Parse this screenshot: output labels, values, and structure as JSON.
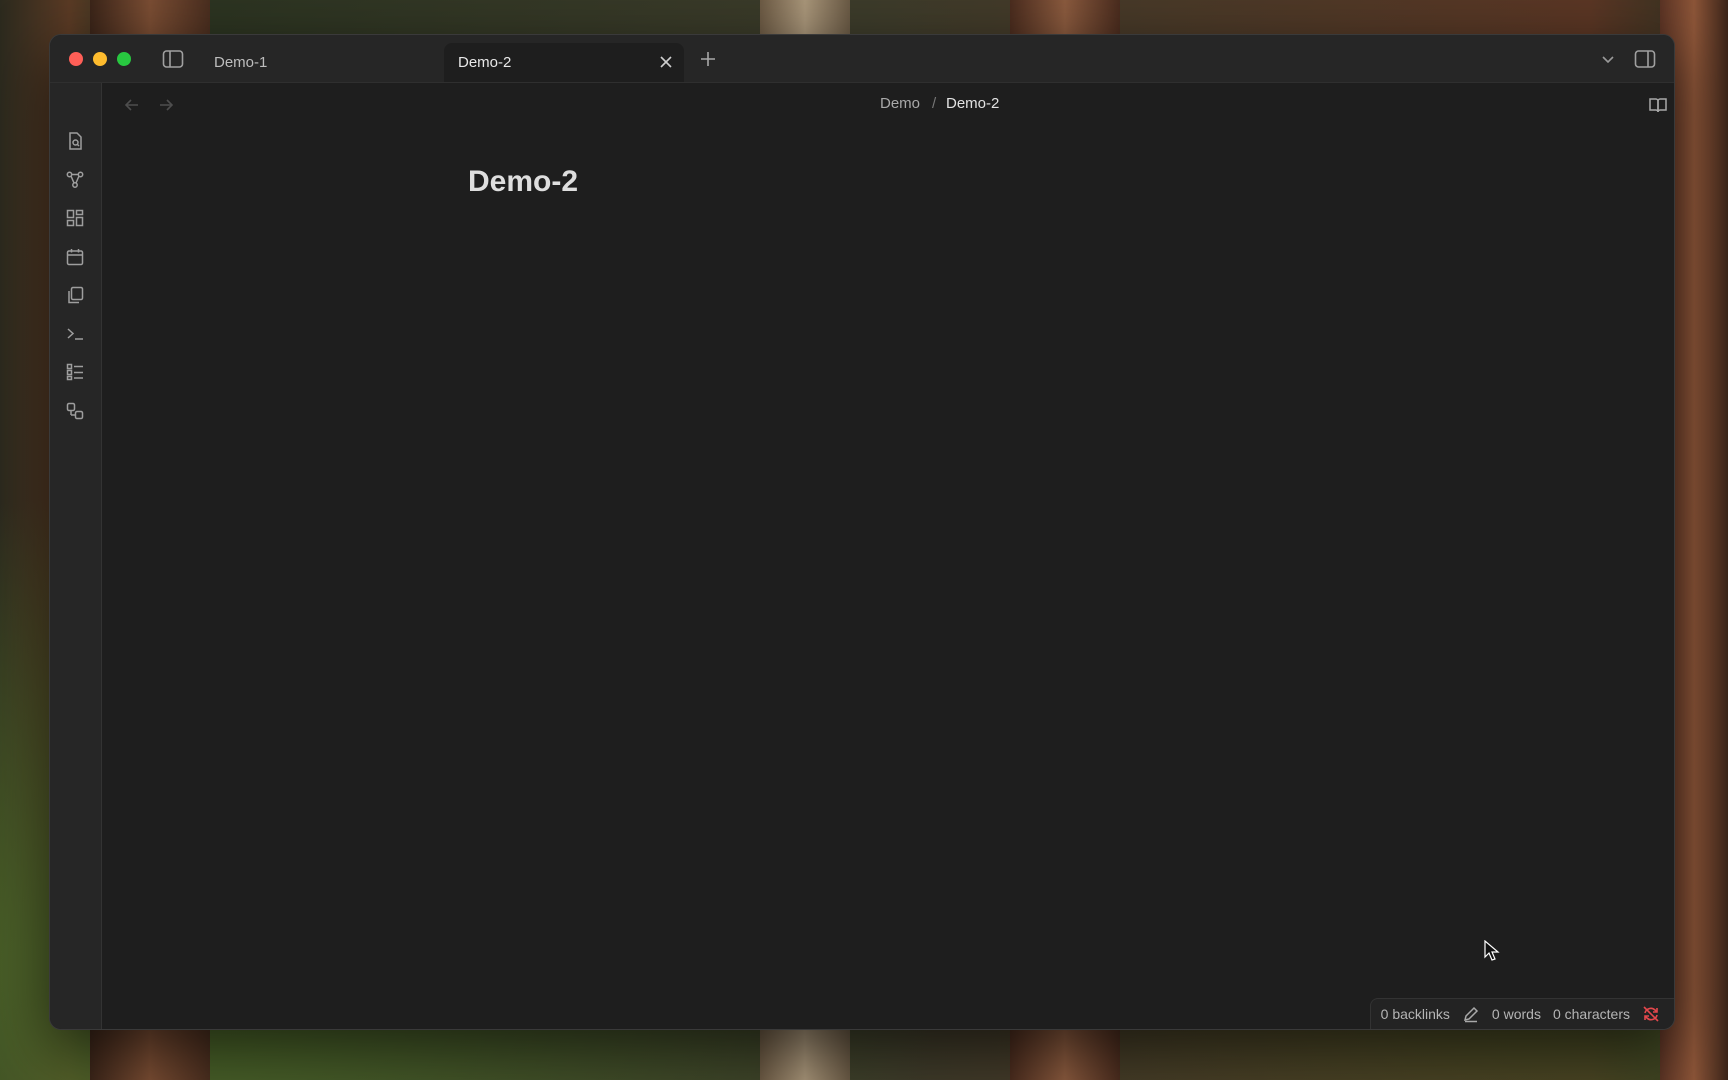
{
  "tabs": [
    {
      "label": "Demo-1",
      "active": false
    },
    {
      "label": "Demo-2",
      "active": true
    }
  ],
  "breadcrumb": {
    "folder": "Demo",
    "separator": "/",
    "file": "Demo-2"
  },
  "note": {
    "title": "Demo-2"
  },
  "status": {
    "backlinks": "0 backlinks",
    "words": "0 words",
    "characters": "0 characters"
  },
  "ribbon_icons": [
    "file-search-icon",
    "graph-icon",
    "dashboard-icon",
    "calendar-icon",
    "copy-icon",
    "terminal-icon",
    "list-icon",
    "shapes-icon"
  ],
  "colors": {
    "accent_red": "#e5484d",
    "background": "#1e1e1e",
    "chrome": "#262626"
  }
}
